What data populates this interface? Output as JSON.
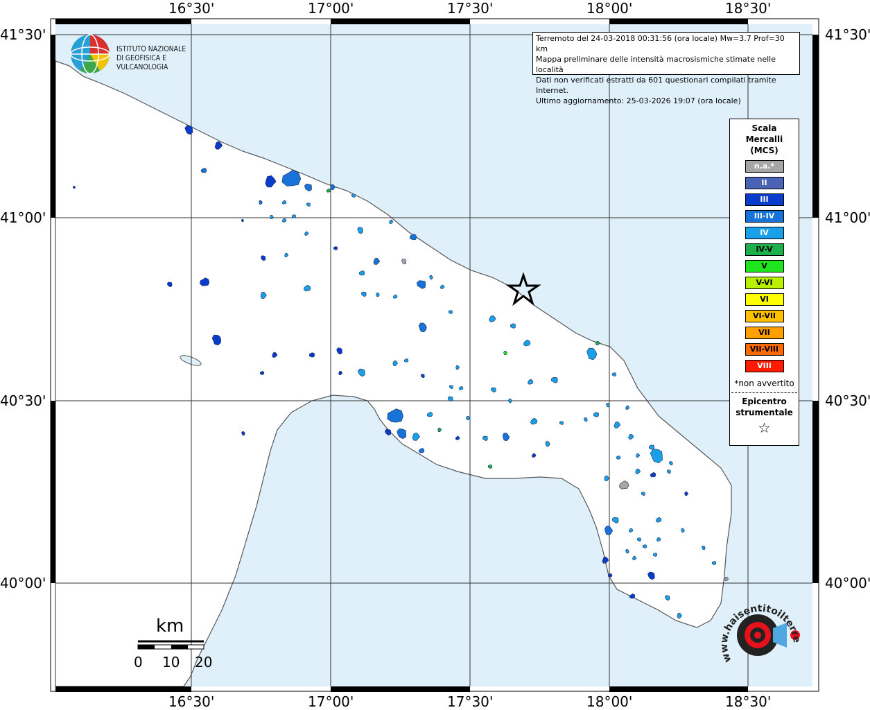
{
  "map": {
    "top_labels": [
      "16°30'",
      "17°00'",
      "17°30'",
      "18°00'",
      "18°30'"
    ],
    "bottom_labels": [
      "16°30'",
      "17°00'",
      "17°30'",
      "18°00'",
      "18°30'"
    ],
    "left_labels": [
      "41°30'",
      "41°00'",
      "40°30'",
      "40°00'"
    ],
    "right_labels": [
      "41°30'",
      "41°00'",
      "40°30'",
      "40°00'"
    ],
    "colors": {
      "sea": "#dff0fb",
      "land": "#ffffff",
      "coast": "#555555",
      "grid": "#333333"
    }
  },
  "logo": {
    "line1": "ISTITUTO NAZIONALE",
    "line2": "DI GEOFISICA E VULCANOLOGIA"
  },
  "info": {
    "line1": "Terremoto del 24-03-2018 00:31:56 (ora locale) Mw=3.7 Prof=30 km",
    "line2": "Mappa preliminare delle intensità macrosismiche stimate nelle località",
    "line3": "Dati non verificati estratti da 601 questionari compilati tramite Internet.",
    "line4": "Ultimo aggiornamento: 25-03-2026 19:07 (ora locale)"
  },
  "legend": {
    "title1": "Scala",
    "title2": "Mercalli",
    "title3": "(MCS)",
    "items": [
      {
        "label": "n.a.*",
        "color": "#a6a6a6",
        "text_color": "#ffffff"
      },
      {
        "label": "II",
        "color": "#4a63b5",
        "text_color": "#ffffff"
      },
      {
        "label": "III",
        "color": "#0a3ccc",
        "text_color": "#ffffff"
      },
      {
        "label": "III-IV",
        "color": "#1873d8",
        "text_color": "#ffffff"
      },
      {
        "label": "IV",
        "color": "#1aa0e8",
        "text_color": "#ffffff"
      },
      {
        "label": "IV-V",
        "color": "#1bb04a",
        "text_color": "#000000"
      },
      {
        "label": "V",
        "color": "#1fe51f",
        "text_color": "#000000"
      },
      {
        "label": "V-VI",
        "color": "#b8f000",
        "text_color": "#000000"
      },
      {
        "label": "VI",
        "color": "#ffff00",
        "text_color": "#000000"
      },
      {
        "label": "VI-VII",
        "color": "#ffc000",
        "text_color": "#000000"
      },
      {
        "label": "VII",
        "color": "#ff9f00",
        "text_color": "#000000"
      },
      {
        "label": "VII-VIII",
        "color": "#ff6a00",
        "text_color": "#000000"
      },
      {
        "label": "VIII",
        "color": "#ff1a00",
        "text_color": "#ffffff"
      }
    ],
    "note": "*non avvertito",
    "epicenter1": "Epicentro",
    "epicenter2": "strumentale",
    "star": "☆"
  },
  "scalebar": {
    "unit": "km",
    "ticks": [
      "0",
      "10",
      "20"
    ]
  },
  "hsi": {
    "text": "www.haisentitoilterremoto.it"
  }
}
